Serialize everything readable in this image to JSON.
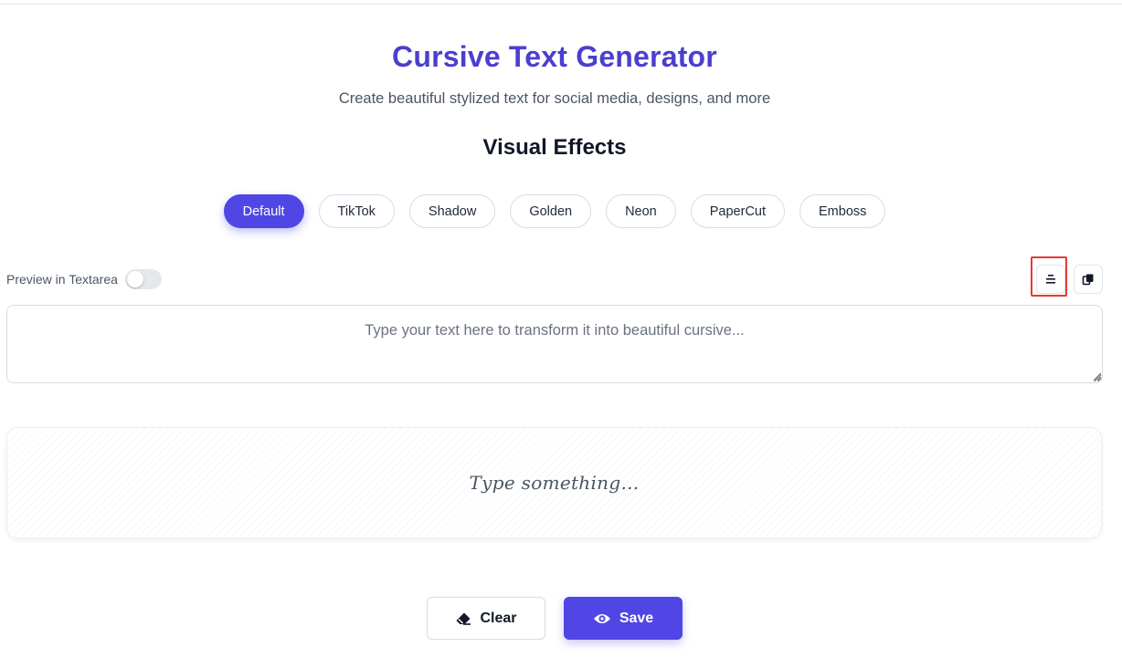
{
  "header": {
    "title": "Cursive Text Generator",
    "subtitle": "Create beautiful stylized text for social media, designs, and more"
  },
  "effects": {
    "heading": "Visual Effects",
    "items": [
      {
        "label": "Default",
        "active": true
      },
      {
        "label": "TikTok",
        "active": false
      },
      {
        "label": "Shadow",
        "active": false
      },
      {
        "label": "Golden",
        "active": false
      },
      {
        "label": "Neon",
        "active": false
      },
      {
        "label": "PaperCut",
        "active": false
      },
      {
        "label": "Emboss",
        "active": false
      }
    ]
  },
  "toolbar": {
    "preview_toggle_label": "Preview in Textarea",
    "preview_toggle_on": false,
    "align_icon": "align-center-icon",
    "copy_icon": "copy-icon"
  },
  "input": {
    "value": "",
    "placeholder": "Type your text here to transform it into beautiful cursive..."
  },
  "preview": {
    "text": "Type something..."
  },
  "actions": {
    "clear_label": "Clear",
    "clear_icon": "eraser-icon",
    "save_label": "Save",
    "save_icon": "eye-icon"
  },
  "colors": {
    "accent": "#4f46e5",
    "title": "#4a3fcf",
    "highlight": "#e53935"
  }
}
